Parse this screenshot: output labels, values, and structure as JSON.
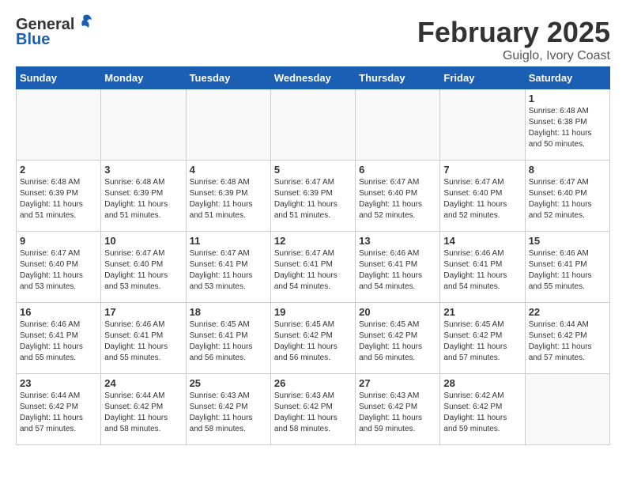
{
  "header": {
    "logo_general": "General",
    "logo_blue": "Blue",
    "title": "February 2025",
    "subtitle": "Guiglo, Ivory Coast"
  },
  "weekdays": [
    "Sunday",
    "Monday",
    "Tuesday",
    "Wednesday",
    "Thursday",
    "Friday",
    "Saturday"
  ],
  "weeks": [
    [
      {
        "day": "",
        "info": ""
      },
      {
        "day": "",
        "info": ""
      },
      {
        "day": "",
        "info": ""
      },
      {
        "day": "",
        "info": ""
      },
      {
        "day": "",
        "info": ""
      },
      {
        "day": "",
        "info": ""
      },
      {
        "day": "1",
        "info": "Sunrise: 6:48 AM\nSunset: 6:38 PM\nDaylight: 11 hours and 50 minutes."
      }
    ],
    [
      {
        "day": "2",
        "info": "Sunrise: 6:48 AM\nSunset: 6:39 PM\nDaylight: 11 hours and 51 minutes."
      },
      {
        "day": "3",
        "info": "Sunrise: 6:48 AM\nSunset: 6:39 PM\nDaylight: 11 hours and 51 minutes."
      },
      {
        "day": "4",
        "info": "Sunrise: 6:48 AM\nSunset: 6:39 PM\nDaylight: 11 hours and 51 minutes."
      },
      {
        "day": "5",
        "info": "Sunrise: 6:47 AM\nSunset: 6:39 PM\nDaylight: 11 hours and 51 minutes."
      },
      {
        "day": "6",
        "info": "Sunrise: 6:47 AM\nSunset: 6:40 PM\nDaylight: 11 hours and 52 minutes."
      },
      {
        "day": "7",
        "info": "Sunrise: 6:47 AM\nSunset: 6:40 PM\nDaylight: 11 hours and 52 minutes."
      },
      {
        "day": "8",
        "info": "Sunrise: 6:47 AM\nSunset: 6:40 PM\nDaylight: 11 hours and 52 minutes."
      }
    ],
    [
      {
        "day": "9",
        "info": "Sunrise: 6:47 AM\nSunset: 6:40 PM\nDaylight: 11 hours and 53 minutes."
      },
      {
        "day": "10",
        "info": "Sunrise: 6:47 AM\nSunset: 6:40 PM\nDaylight: 11 hours and 53 minutes."
      },
      {
        "day": "11",
        "info": "Sunrise: 6:47 AM\nSunset: 6:41 PM\nDaylight: 11 hours and 53 minutes."
      },
      {
        "day": "12",
        "info": "Sunrise: 6:47 AM\nSunset: 6:41 PM\nDaylight: 11 hours and 54 minutes."
      },
      {
        "day": "13",
        "info": "Sunrise: 6:46 AM\nSunset: 6:41 PM\nDaylight: 11 hours and 54 minutes."
      },
      {
        "day": "14",
        "info": "Sunrise: 6:46 AM\nSunset: 6:41 PM\nDaylight: 11 hours and 54 minutes."
      },
      {
        "day": "15",
        "info": "Sunrise: 6:46 AM\nSunset: 6:41 PM\nDaylight: 11 hours and 55 minutes."
      }
    ],
    [
      {
        "day": "16",
        "info": "Sunrise: 6:46 AM\nSunset: 6:41 PM\nDaylight: 11 hours and 55 minutes."
      },
      {
        "day": "17",
        "info": "Sunrise: 6:46 AM\nSunset: 6:41 PM\nDaylight: 11 hours and 55 minutes."
      },
      {
        "day": "18",
        "info": "Sunrise: 6:45 AM\nSunset: 6:41 PM\nDaylight: 11 hours and 56 minutes."
      },
      {
        "day": "19",
        "info": "Sunrise: 6:45 AM\nSunset: 6:42 PM\nDaylight: 11 hours and 56 minutes."
      },
      {
        "day": "20",
        "info": "Sunrise: 6:45 AM\nSunset: 6:42 PM\nDaylight: 11 hours and 56 minutes."
      },
      {
        "day": "21",
        "info": "Sunrise: 6:45 AM\nSunset: 6:42 PM\nDaylight: 11 hours and 57 minutes."
      },
      {
        "day": "22",
        "info": "Sunrise: 6:44 AM\nSunset: 6:42 PM\nDaylight: 11 hours and 57 minutes."
      }
    ],
    [
      {
        "day": "23",
        "info": "Sunrise: 6:44 AM\nSunset: 6:42 PM\nDaylight: 11 hours and 57 minutes."
      },
      {
        "day": "24",
        "info": "Sunrise: 6:44 AM\nSunset: 6:42 PM\nDaylight: 11 hours and 58 minutes."
      },
      {
        "day": "25",
        "info": "Sunrise: 6:43 AM\nSunset: 6:42 PM\nDaylight: 11 hours and 58 minutes."
      },
      {
        "day": "26",
        "info": "Sunrise: 6:43 AM\nSunset: 6:42 PM\nDaylight: 11 hours and 58 minutes."
      },
      {
        "day": "27",
        "info": "Sunrise: 6:43 AM\nSunset: 6:42 PM\nDaylight: 11 hours and 59 minutes."
      },
      {
        "day": "28",
        "info": "Sunrise: 6:42 AM\nSunset: 6:42 PM\nDaylight: 11 hours and 59 minutes."
      },
      {
        "day": "",
        "info": ""
      }
    ]
  ]
}
